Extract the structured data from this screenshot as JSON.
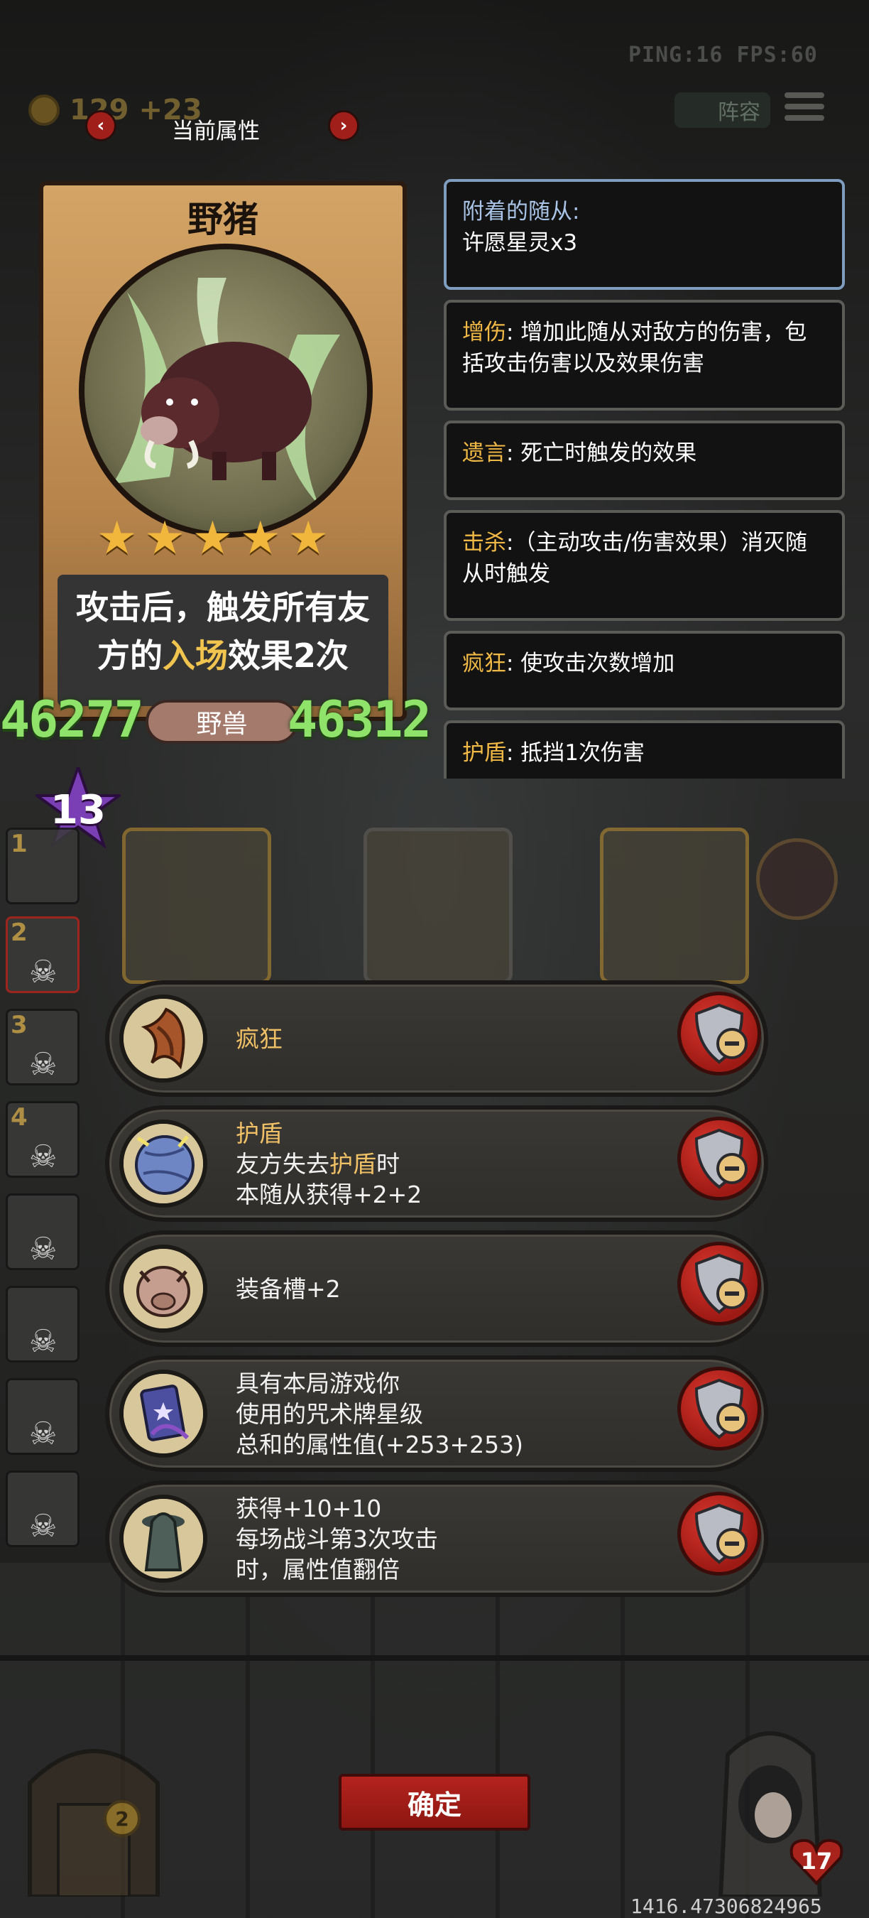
{
  "hud": {
    "ping_fps": "PING:16   FPS:60",
    "gold": "129",
    "gold_income": "+23",
    "lineup_label": "阵容"
  },
  "attribute_panel": {
    "title": "当前属性"
  },
  "minion_card": {
    "name": "野猪",
    "stars": 5,
    "description_prefix": "攻击后，触发所有友",
    "description_mid_a": "方的",
    "description_keyword": "入场",
    "description_mid_b": "效果2次",
    "attack": "46277",
    "health": "46312",
    "tribe": "野兽",
    "level": "13"
  },
  "keywords": [
    {
      "tag": "附着的随从:",
      "text": "许愿星灵x3"
    },
    {
      "tag": "增伤",
      "text": ": 增加此随从对敌方的伤害，包括攻击伤害以及效果伤害"
    },
    {
      "tag": "遗言",
      "text": ": 死亡时触发的效果"
    },
    {
      "tag": "击杀",
      "text": ":（主动攻击/伤害效果）消灭随从时触发"
    },
    {
      "tag": "疯狂",
      "text": ": 使攻击次数增加"
    },
    {
      "tag": "护盾",
      "text": ": 抵挡1次伤害"
    }
  ],
  "side_slots": [
    "1",
    "2",
    "3",
    "4"
  ],
  "effects": [
    {
      "icon": "frenzy-claw-icon",
      "title": "疯狂"
    },
    {
      "icon": "shield-orb-icon",
      "title": "护盾",
      "line2_a": "友方失去",
      "line2_hl": "护盾",
      "line2_b": "时",
      "line3": "本随从获得+2+2"
    },
    {
      "icon": "pig-head-icon",
      "text": "装备槽+2"
    },
    {
      "icon": "spell-card-icon",
      "line1": "具有本局游戏你",
      "line2": "使用的咒术牌星级",
      "line3": "总和的属性值(+253+253)"
    },
    {
      "icon": "shadow-figure-icon",
      "line1": "获得+10+10",
      "line2": "每场战斗第3次攻击",
      "line3": "时，属性值翻倍"
    }
  ],
  "bottom": {
    "confirm_label": "确定",
    "coins_left": "2",
    "hero_health": "17",
    "coordinate": "1416.47306824965"
  },
  "colors": {
    "highlight": "#f0c067",
    "stat_green": "#8fe26a",
    "confirm_red": "#b4231d",
    "attach_border": "#7f9dbe"
  }
}
